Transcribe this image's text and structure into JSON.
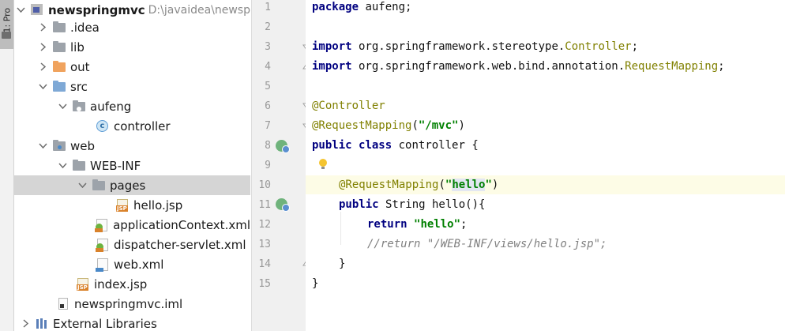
{
  "sidebar": {
    "tab_label": "1: Pro"
  },
  "tree": {
    "rows": [
      {
        "label": "newspringmvc",
        "path": "D:\\javaidea\\newsp"
      },
      {
        "label": ".idea"
      },
      {
        "label": "lib"
      },
      {
        "label": "out"
      },
      {
        "label": "src"
      },
      {
        "label": "aufeng"
      },
      {
        "label": "controller",
        "icon_text": "c"
      },
      {
        "label": "web"
      },
      {
        "label": "WEB-INF"
      },
      {
        "label": "pages"
      },
      {
        "label": "hello.jsp",
        "badge": "JSP"
      },
      {
        "label": "applicationContext.xml"
      },
      {
        "label": "dispatcher-servlet.xml"
      },
      {
        "label": "web.xml"
      },
      {
        "label": "index.jsp",
        "badge": "JSP"
      },
      {
        "label": "newspringmvc.iml"
      },
      {
        "label": "External Libraries"
      }
    ]
  },
  "editor": {
    "line_numbers": [
      "1",
      "2",
      "3",
      "4",
      "5",
      "6",
      "7",
      "8",
      "9",
      "10",
      "11",
      "12",
      "13",
      "14",
      "15"
    ],
    "lines": {
      "l1": {
        "kw": "package",
        "rest": " aufeng;"
      },
      "l3": {
        "kw": "import",
        "pkg": " org.springframework.stereotype.",
        "cls": "Controller",
        "end": ";"
      },
      "l4": {
        "kw": "import",
        "pkg": " org.springframework.web.bind.annotation.",
        "cls": "RequestMapping",
        "end": ";"
      },
      "l6": {
        "ann": "@Controller"
      },
      "l7": {
        "ann": "@RequestMapping",
        "open": "(",
        "str": "\"/mvc\"",
        "close": ")"
      },
      "l8": {
        "kw1": "public",
        "kw2": "class",
        "rest": " controller {"
      },
      "l10": {
        "ann": "@RequestMapping",
        "open": "(",
        "q1": "\"",
        "str": "hello",
        "q2": "\"",
        "close": ")"
      },
      "l11": {
        "kw": "public",
        "rest": " String hello(){"
      },
      "l12": {
        "kw": "return",
        "str": "\"hello\"",
        "end": ";"
      },
      "l13": {
        "cmt": "//return \"/WEB-INF/views/hello.jsp\";"
      },
      "l14": {
        "text": "}"
      },
      "l15": {
        "text": "}"
      }
    }
  },
  "colors": {
    "keyword": "#000080",
    "annotation": "#808000",
    "string": "#008000",
    "comment": "#808080",
    "current_line": "#fdfce6",
    "selection": "#d5d5d5"
  }
}
